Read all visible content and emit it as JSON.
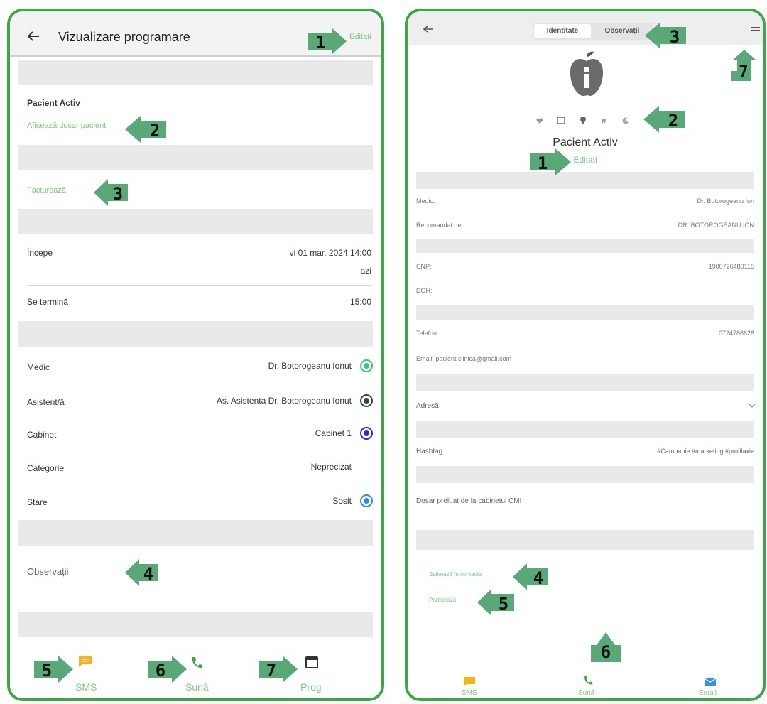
{
  "left": {
    "header": {
      "title": "Vizualizare programare",
      "edit": "Editați"
    },
    "patient": {
      "name": "Pacient Activ",
      "show_file": "Afișează dosar pacient"
    },
    "invoice": "Facturează",
    "start": {
      "label": "Începe",
      "value": "vi 01 mar. 2024 14:00",
      "sub": "azi"
    },
    "end": {
      "label": "Se termină",
      "value": "15:00"
    },
    "fields": [
      {
        "label": "Medic",
        "value": "Dr. Botorogeanu Ionut"
      },
      {
        "label": "Asistent/ă",
        "value": "As. Asistenta Dr. Botorogeanu Ionut"
      },
      {
        "label": "Cabinet",
        "value": "Cabinet 1"
      },
      {
        "label": "Categorie",
        "value": "Neprecizat"
      },
      {
        "label": "Stare",
        "value": "Sosit"
      }
    ],
    "observations": "Observații",
    "tabbar": {
      "sms": "SMS",
      "call": "Sună",
      "prog": "Prog"
    },
    "callouts": [
      "1",
      "2",
      "3",
      "4",
      "5",
      "6",
      "7"
    ],
    "colors": {
      "medic_dot": "#35c87a",
      "assistant_dot": "#2f4a3a",
      "cabinet_dot": "#2b2bd0",
      "stare_dot": "#2a8fe0"
    }
  },
  "right": {
    "header": {
      "tab_identity": "Identitate",
      "tab_observations": "Observații"
    },
    "patient_name": "Pacient Activ",
    "edit": "Editați",
    "rows": [
      {
        "label": "Medic:",
        "value": "Dr. Botorogeanu Ion"
      },
      {
        "label": "Recomandat de:",
        "value": "DR. BOTOROGEANU ION"
      },
      {
        "label": "CNP:",
        "value": "1900726480115"
      },
      {
        "label": "DOH:",
        "value": "-"
      },
      {
        "label": "Telefon:",
        "value": "0724786628"
      },
      {
        "label": "Email: pacient.clinica@gmail.com",
        "value": ""
      }
    ],
    "address": "Adresă",
    "hashtag": {
      "label": "Hashtag",
      "value": "#Campanie #marketing #profilaxie"
    },
    "note": "Dosar preluat de la cabinetul CMI",
    "links": {
      "save_contact": "Salvează în contacte",
      "share": "Partajează"
    },
    "tabbar": {
      "sms": "SMS",
      "call": "Sună",
      "email": "Email"
    },
    "callouts": [
      "1",
      "2",
      "3",
      "4",
      "5",
      "6",
      "7"
    ]
  },
  "colors": {
    "frame": "#3aa843",
    "link": "#7cc87e",
    "arrow": "#5aa777",
    "sms": "#f5b21b",
    "email": "#3d8fe0"
  }
}
